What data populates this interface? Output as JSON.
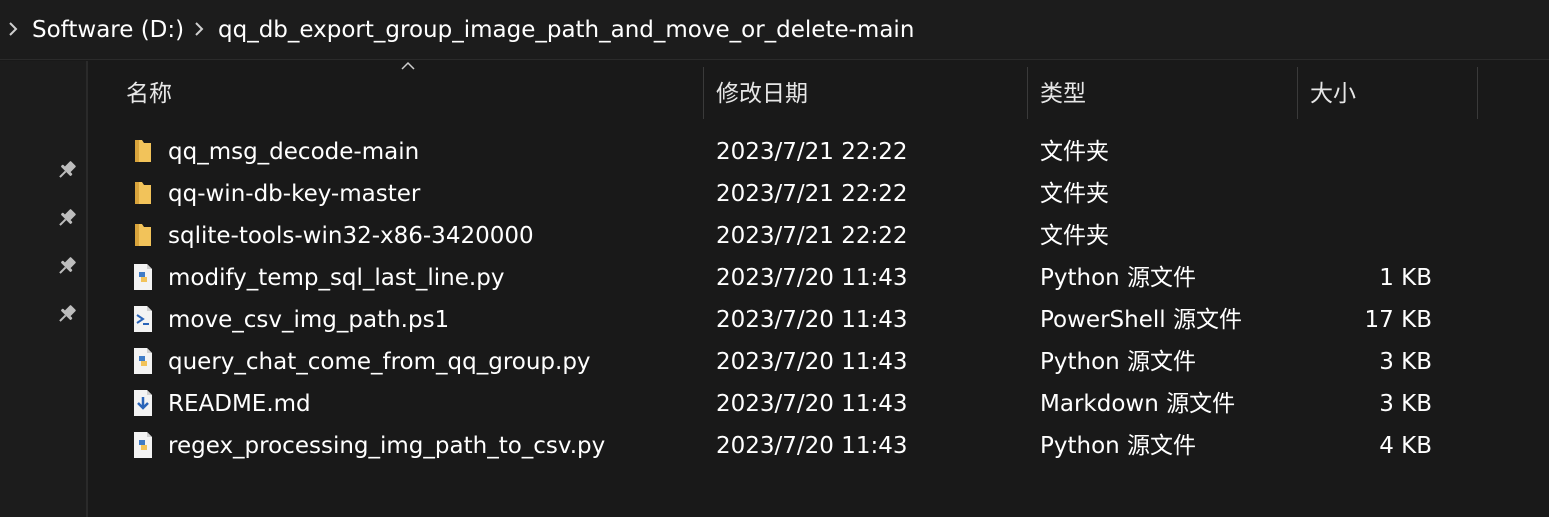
{
  "breadcrumb": {
    "items": [
      {
        "label": "Software (D:)"
      },
      {
        "label": "qq_db_export_group_image_path_and_move_or_delete-main"
      }
    ]
  },
  "columns": {
    "name": "名称",
    "modified": "修改日期",
    "type": "类型",
    "size": "大小"
  },
  "sort": {
    "column": "name",
    "direction": "ascending"
  },
  "colors": {
    "background": "#191919",
    "folder": "#f2c35a",
    "python": "#3f7cc7",
    "powershell": "#2a64b8",
    "markdown": "#2a64b8"
  },
  "files": [
    {
      "name": "qq_msg_decode-main",
      "modified": "2023/7/21 22:22",
      "type": "文件夹",
      "size": "",
      "icon": "folder-icon"
    },
    {
      "name": "qq-win-db-key-master",
      "modified": "2023/7/21 22:22",
      "type": "文件夹",
      "size": "",
      "icon": "folder-icon"
    },
    {
      "name": "sqlite-tools-win32-x86-3420000",
      "modified": "2023/7/21 22:22",
      "type": "文件夹",
      "size": "",
      "icon": "folder-icon"
    },
    {
      "name": "modify_temp_sql_last_line.py",
      "modified": "2023/7/20 11:43",
      "type": "Python 源文件",
      "size": "1 KB",
      "icon": "python-file-icon"
    },
    {
      "name": "move_csv_img_path.ps1",
      "modified": "2023/7/20 11:43",
      "type": "PowerShell 源文件",
      "size": "17 KB",
      "icon": "powershell-file-icon"
    },
    {
      "name": "query_chat_come_from_qq_group.py",
      "modified": "2023/7/20 11:43",
      "type": "Python 源文件",
      "size": "3 KB",
      "icon": "python-file-icon"
    },
    {
      "name": "README.md",
      "modified": "2023/7/20 11:43",
      "type": "Markdown 源文件",
      "size": "3 KB",
      "icon": "markdown-file-icon"
    },
    {
      "name": "regex_processing_img_path_to_csv.py",
      "modified": "2023/7/20 11:43",
      "type": "Python 源文件",
      "size": "4 KB",
      "icon": "python-file-icon"
    }
  ],
  "nav": {
    "pins": [
      "pin-icon",
      "pin-icon",
      "pin-icon",
      "pin-icon"
    ]
  }
}
